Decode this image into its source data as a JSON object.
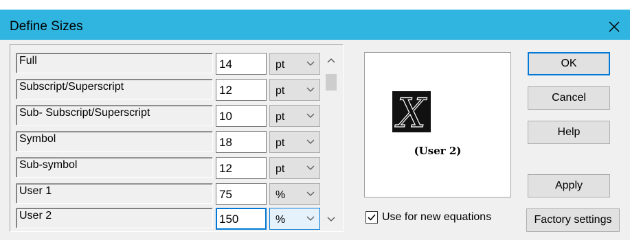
{
  "window": {
    "title": "Define Sizes"
  },
  "sizes": [
    {
      "label": "Full",
      "value": "14",
      "unit": "pt"
    },
    {
      "label": "Subscript/Superscript",
      "value": "12",
      "unit": "pt"
    },
    {
      "label": "Sub- Subscript/Superscript",
      "value": "10",
      "unit": "pt"
    },
    {
      "label": "Symbol",
      "value": "18",
      "unit": "pt"
    },
    {
      "label": "Sub-symbol",
      "value": "12",
      "unit": "pt"
    },
    {
      "label": "User 1",
      "value": "75",
      "unit": "%"
    },
    {
      "label": "User 2",
      "value": "150",
      "unit": "%"
    }
  ],
  "preview": {
    "glyph": "X",
    "label": "(User 2)"
  },
  "use_for_new": {
    "label": "Use for new equations",
    "checked": true
  },
  "buttons": {
    "ok": "OK",
    "cancel": "Cancel",
    "help": "Help",
    "apply": "Apply",
    "factory": "Factory settings"
  },
  "colors": {
    "title_bar": "#2fb5e0",
    "focus": "#0078d7"
  }
}
